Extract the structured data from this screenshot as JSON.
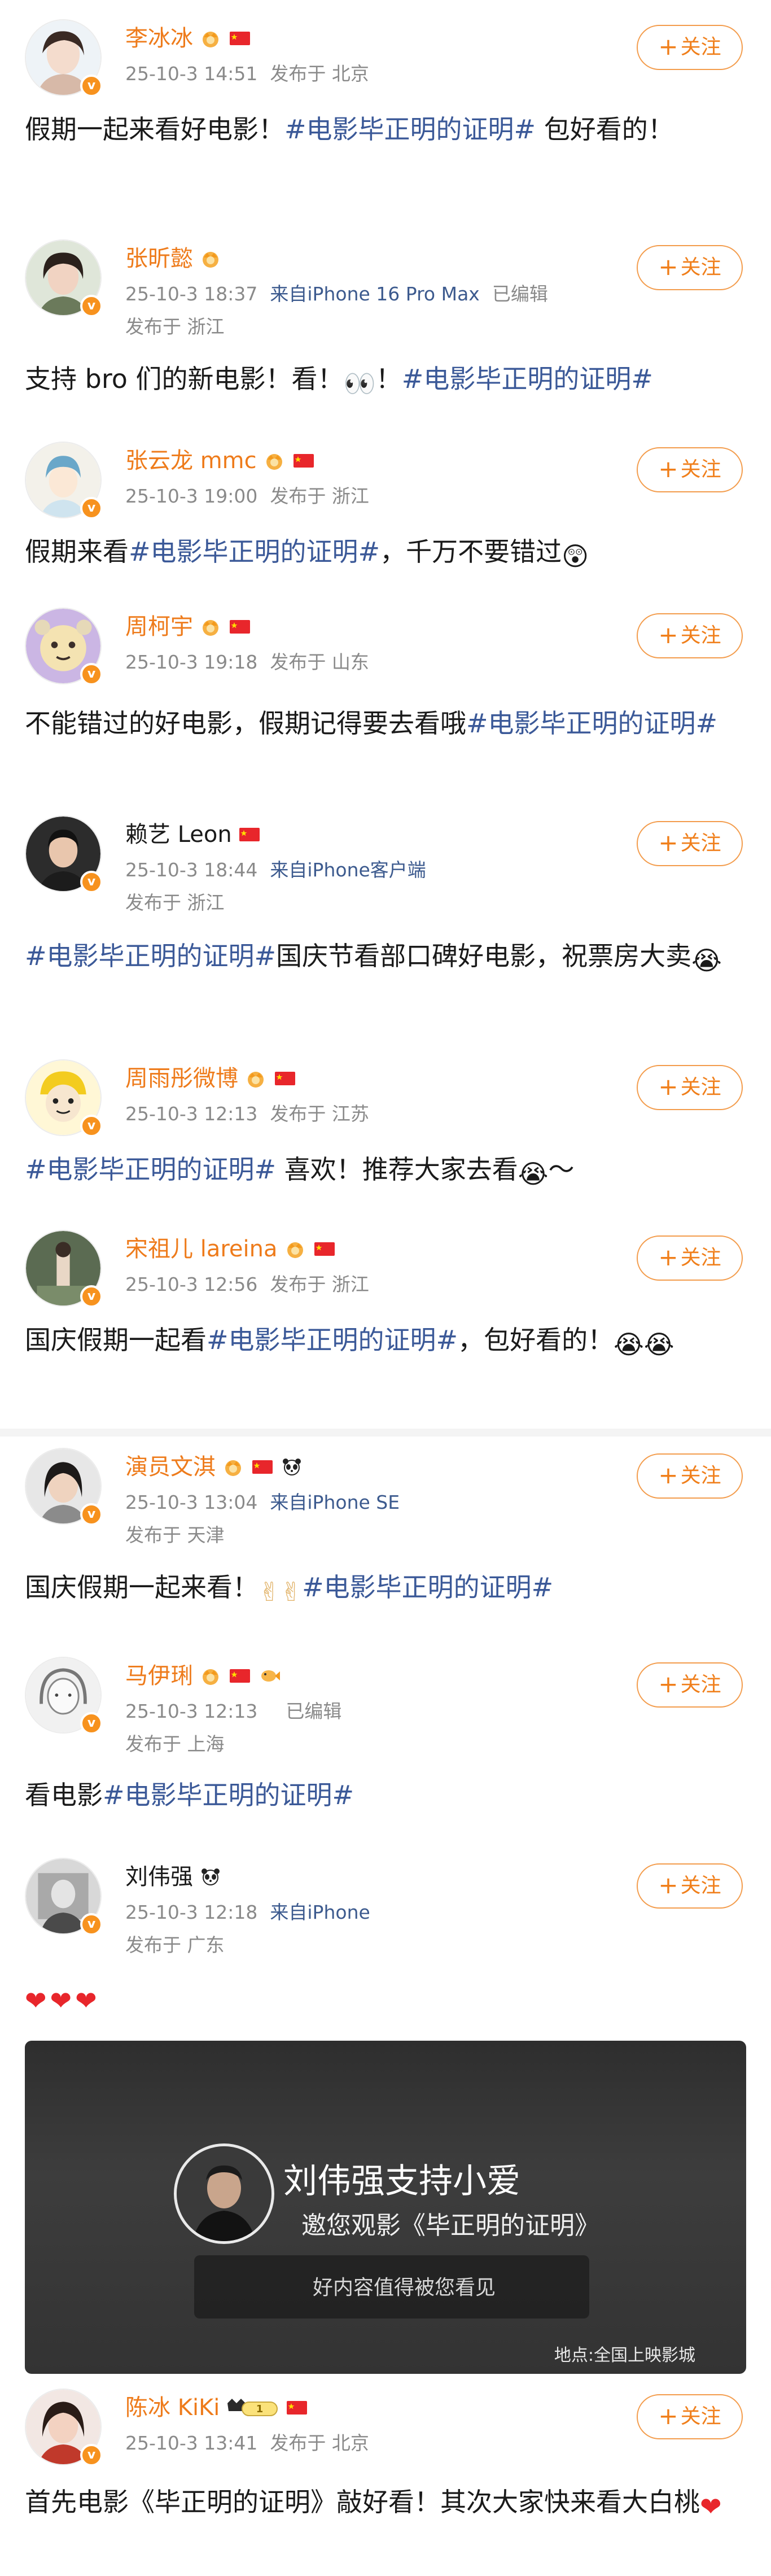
{
  "follow_label": "关注",
  "colors": {
    "accent": "#ee7b1b",
    "hashtag": "#3b5998",
    "meta": "#8a8a8a"
  },
  "posts": [
    {
      "name": "李冰冰",
      "time": "25-10-3 14:51",
      "location": "发布于 北京",
      "content": [
        "假期一起来看好电影！",
        "#电影毕正明的证明#",
        " 包好看的！"
      ],
      "badges": [
        "crown-badge",
        "china-flag"
      ]
    },
    {
      "name": "张昕懿",
      "time": "25-10-3 18:37",
      "source": "来自iPhone 16 Pro Max",
      "edited": "已编辑",
      "location": "发布于 浙江",
      "content": [
        "支持 bro 们的新电影！看！",
        "👀",
        "！",
        "#电影毕正明的证明#"
      ],
      "badges": [
        "crown-badge"
      ]
    },
    {
      "name": "张云龙 mmc",
      "time": "25-10-3 19:00",
      "location": "发布于 浙江",
      "content": [
        "假期来看",
        "#电影毕正明的证明#",
        "，千万不要错过",
        "😲"
      ],
      "badges": [
        "crown-badge",
        "china-flag"
      ]
    },
    {
      "name": "周柯宇",
      "time": "25-10-3 19:18",
      "location": "发布于 山东",
      "content": [
        "不能错过的好电影，假期记得要去看哦",
        "#电影毕正明的证明#"
      ],
      "badges": [
        "crown-badge",
        "china-flag"
      ]
    },
    {
      "name": "赖艺 Leon",
      "time": "25-10-3 18:44",
      "source": "来自iPhone客户端",
      "location": "发布于 浙江",
      "content": [
        "#电影毕正明的证明#",
        "国庆节看部口碑好电影，祝票房大卖",
        "😭"
      ],
      "badges": [
        "china-flag"
      ]
    },
    {
      "name": "周雨彤微博",
      "time": "25-10-3 12:13",
      "location": "发布于 江苏",
      "content": [
        "#电影毕正明的证明#",
        " 喜欢！推荐大家去看",
        "😭",
        "～"
      ],
      "badges": [
        "crown-badge",
        "china-flag"
      ]
    },
    {
      "name": "宋祖儿 lareina",
      "time": "25-10-3 12:56",
      "location": "发布于 浙江",
      "content": [
        "国庆假期一起看",
        "#电影毕正明的证明#",
        "，包好看的！",
        "😭😭"
      ],
      "badges": [
        "crown-badge",
        "china-flag"
      ]
    },
    {
      "name": "演员文淇",
      "time": "25-10-3 13:04",
      "source": "来自iPhone SE",
      "location": "发布于 天津",
      "content": [
        "国庆假期一起来看！",
        "✌✌",
        "#电影毕正明的证明#"
      ],
      "badges": [
        "crown-badge",
        "china-flag",
        "panda-badge"
      ]
    },
    {
      "name": "马伊琍",
      "time": "25-10-3 12:13",
      "edited": "已编辑",
      "location": "发布于 上海",
      "content": [
        "看电影",
        "#电影毕正明的证明#"
      ],
      "badges": [
        "crown-badge",
        "china-flag",
        "fish-badge"
      ]
    },
    {
      "name": "刘伟强",
      "time": "25-10-3 12:18",
      "source": "来自iPhone",
      "location": "发布于 广东",
      "content": [
        "❤❤❤"
      ],
      "badges": [
        "panda-badge"
      ],
      "video": {
        "title": "刘伟强支持小爱",
        "subtitle": "邀您观影《毕正明的证明》",
        "bar": "好内容值得被您看见",
        "location": "地点:全国上映影城"
      }
    },
    {
      "name": "陈冰 KiKi",
      "time": "25-10-3 13:41",
      "location": "发布于 北京",
      "content": [
        "首先电影《毕正明的证明》敲好看！其次大家快来看大白桃",
        "❤"
      ],
      "badges": [
        "crown-level-badge",
        "china-flag"
      ],
      "level": "1"
    }
  ]
}
